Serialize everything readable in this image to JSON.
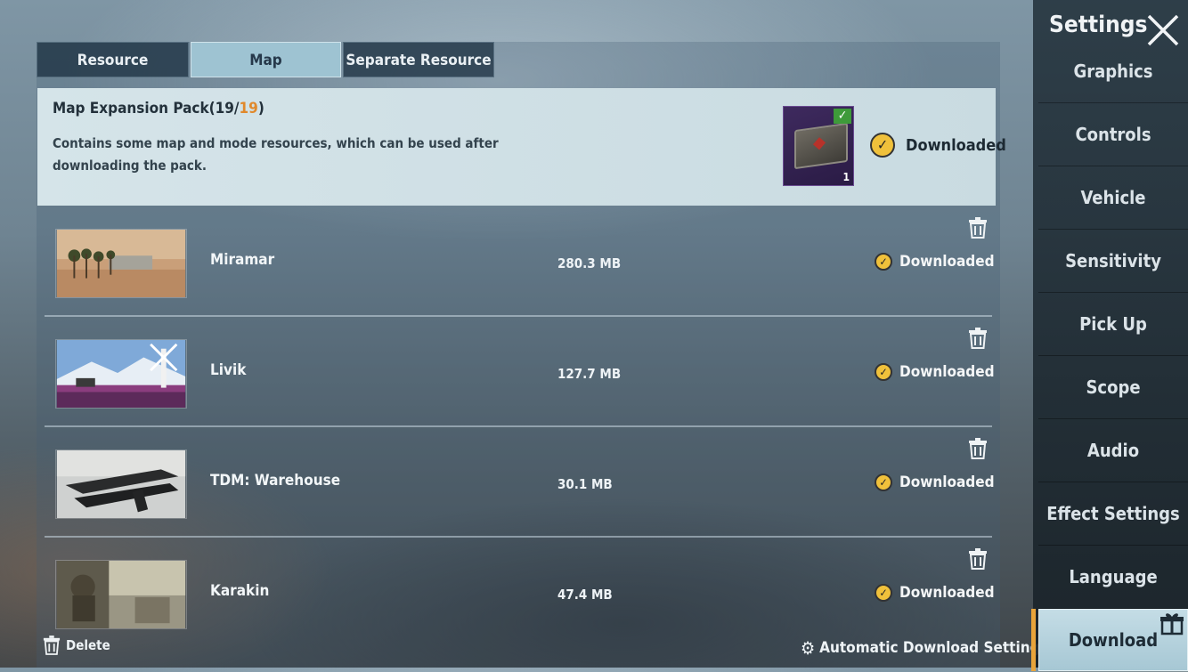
{
  "tabs": [
    {
      "label": "Resource",
      "active": false
    },
    {
      "label": "Map",
      "active": true
    },
    {
      "label": "Separate Resource",
      "active": false
    }
  ],
  "pack": {
    "title_prefix": "Map Expansion Pack(19/",
    "title_highlight": "19",
    "title_suffix": ")",
    "description": "Contains some map and mode resources, which can be used after downloading the pack.",
    "quantity": "1",
    "status": "Downloaded",
    "check_glyph": "✓",
    "badge_glyph": "✓"
  },
  "maps": [
    {
      "name": "Miramar",
      "size": "280.3 MB",
      "status": "Downloaded"
    },
    {
      "name": "Livik",
      "size": "127.7 MB",
      "status": "Downloaded"
    },
    {
      "name": "TDM: Warehouse",
      "size": "30.1 MB",
      "status": "Downloaded"
    },
    {
      "name": "Karakin",
      "size": "47.4 MB",
      "status": "Downloaded"
    }
  ],
  "footer": {
    "delete_label": "Delete",
    "auto_label": "Automatic Download Settings",
    "gear_glyph": "⚙"
  },
  "sidebar": {
    "title": "Settings",
    "items": [
      {
        "label": "Graphics",
        "active": false
      },
      {
        "label": "Controls",
        "active": false
      },
      {
        "label": "Vehicle",
        "active": false
      },
      {
        "label": "Sensitivity",
        "active": false
      },
      {
        "label": "Pick Up",
        "active": false
      },
      {
        "label": "Scope",
        "active": false
      },
      {
        "label": "Audio",
        "active": false
      },
      {
        "label": "Effect Settings",
        "active": false
      },
      {
        "label": "Language",
        "active": false
      },
      {
        "label": "Download",
        "active": true
      }
    ]
  },
  "colors": {
    "accent": "#e9a43a",
    "highlight_number": "#e0892c",
    "badge": "#f0c13b",
    "active_tab": "#9ec3d2"
  }
}
